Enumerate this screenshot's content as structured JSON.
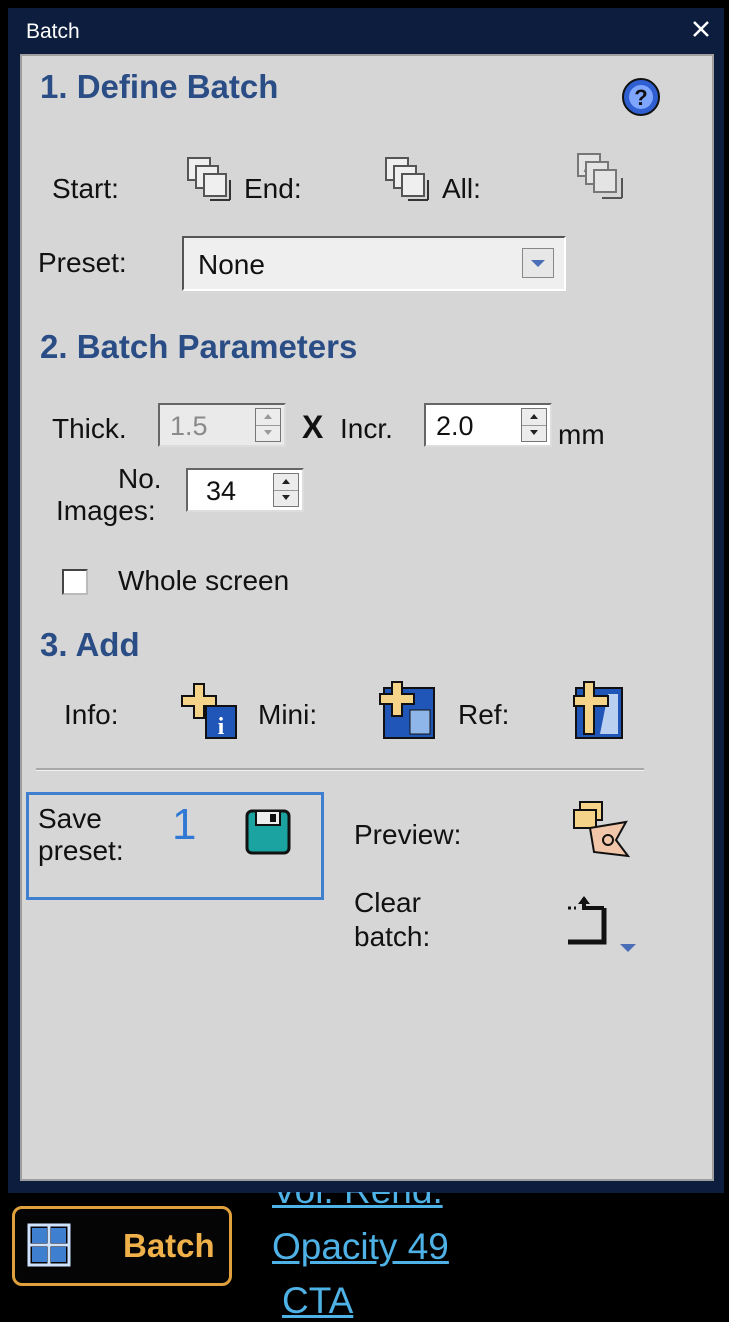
{
  "window": {
    "title": "Batch"
  },
  "section1": {
    "title": "1. Define Batch",
    "start_label": "Start:",
    "end_label": "End:",
    "all_label": "All:",
    "preset_label": "Preset:",
    "preset_value": "None"
  },
  "section2": {
    "title": "2. Batch Parameters",
    "thick_label": "Thick.",
    "thick_value": "1.5",
    "x_sep": "X",
    "incr_label": "Incr.",
    "incr_value": "2.0",
    "unit": "mm",
    "no_label": "No.",
    "images_label": "Images:",
    "images_value": "34",
    "whole_screen_label": "Whole screen",
    "whole_screen_checked": false
  },
  "section3": {
    "title": "3. Add",
    "info_label": "Info:",
    "mini_label": "Mini:",
    "ref_label": "Ref:"
  },
  "actions": {
    "save_label_1": "Save",
    "save_label_2": "preset:",
    "step_marker": "1",
    "preview_label": "Preview:",
    "clear_label_1": "Clear",
    "clear_label_2": "batch:"
  },
  "bottom": {
    "batch_button": "Batch",
    "partial_top": "Vol. Rend.",
    "opacity_link": "Opacity 49",
    "partial_bottom": "CTA"
  },
  "colors": {
    "section_title": "#2b4d86",
    "highlight_border": "#3f7fd0",
    "batch_accent": "#e0a13c",
    "link": "#4fb2e6"
  }
}
